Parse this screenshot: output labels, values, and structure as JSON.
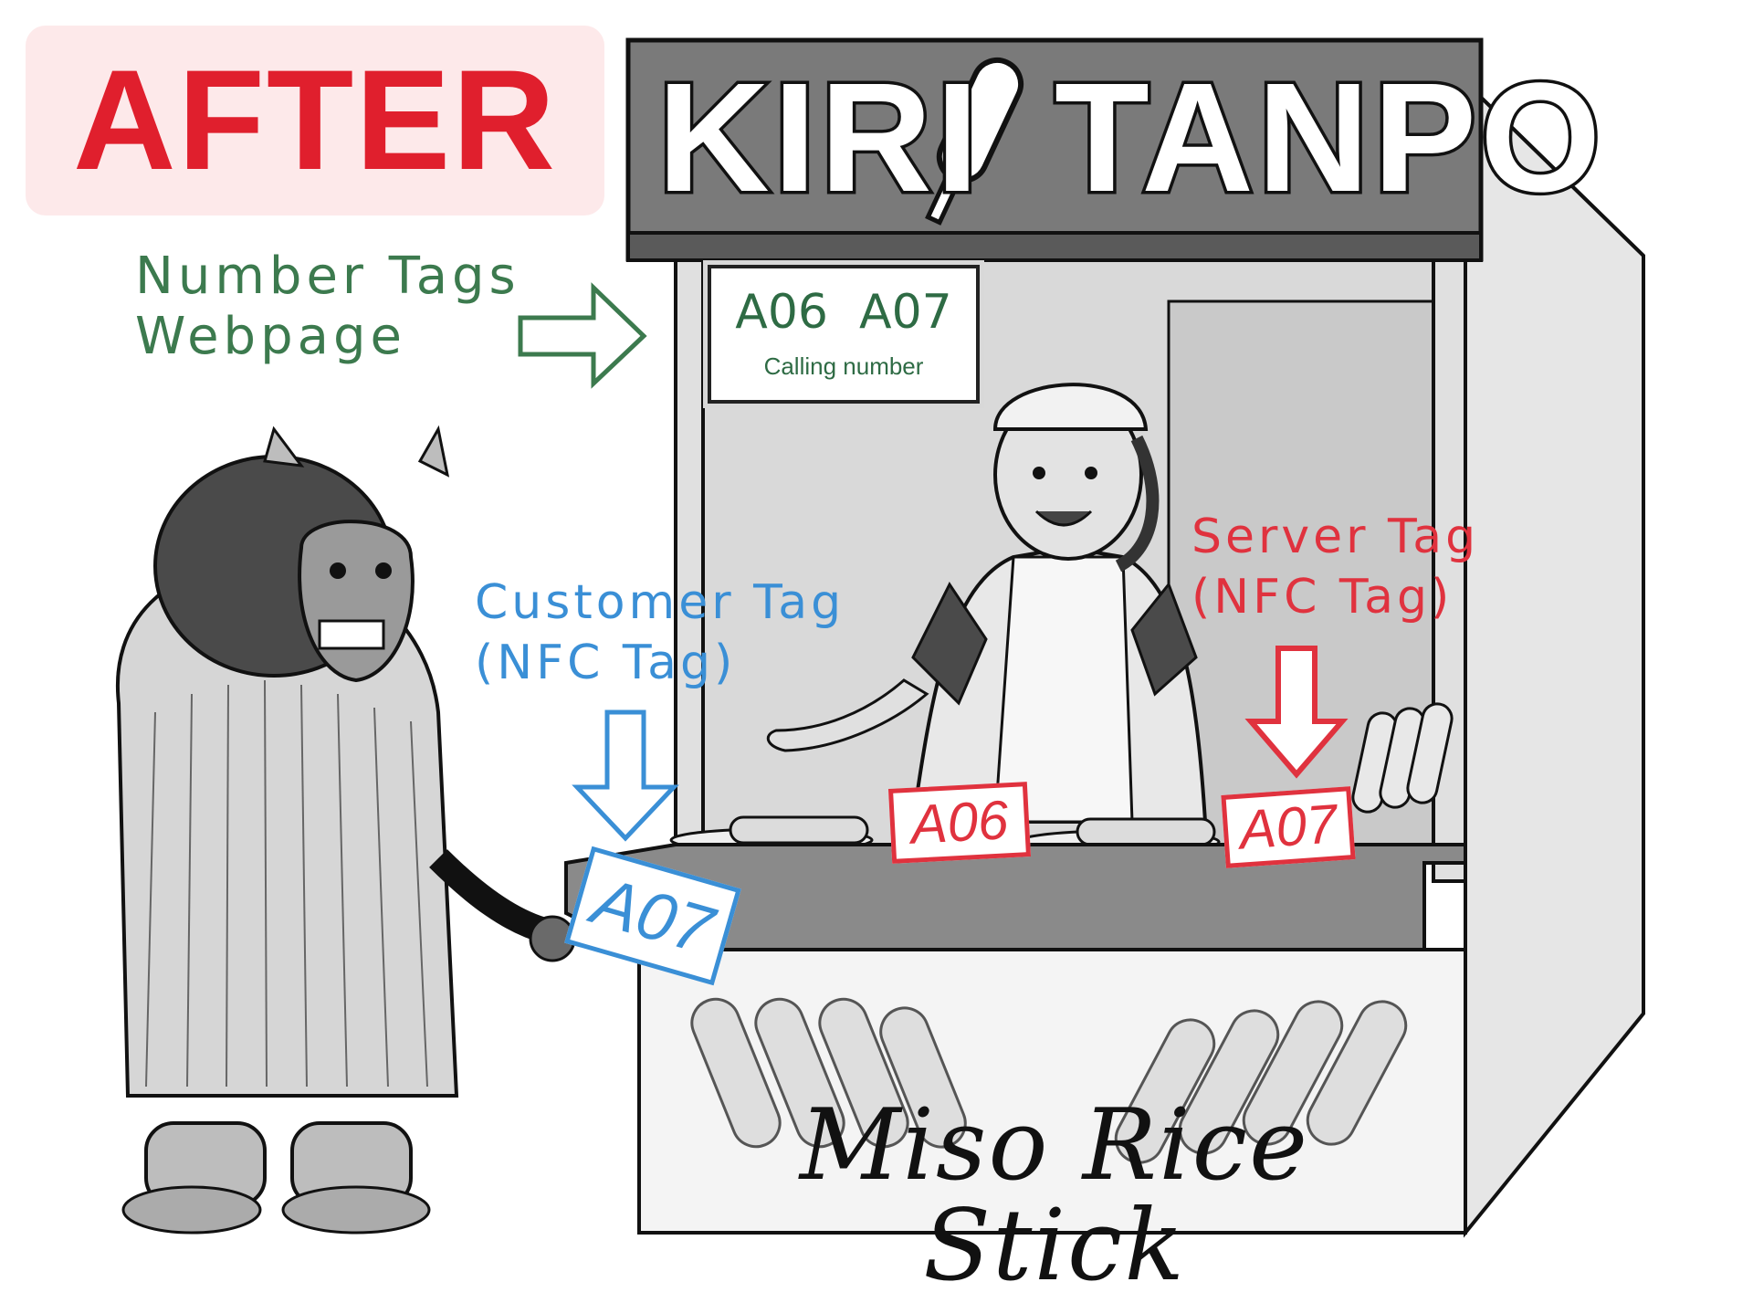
{
  "badge": {
    "label": "AFTER"
  },
  "sign": {
    "left_word": "KIRI",
    "right_word": "TANPO"
  },
  "annotations": {
    "webpage": {
      "line1": "Number Tags",
      "line2": "Webpage"
    },
    "customer_tag": {
      "line1": "Customer Tag",
      "line2": "(NFC Tag)"
    },
    "server_tag": {
      "line1": "Server Tag",
      "line2": "(NFC Tag)"
    }
  },
  "screen": {
    "numbers": [
      "A06",
      "A07"
    ],
    "caption": "Calling number"
  },
  "tags": {
    "counter_a06": "A06",
    "counter_a07": "A07",
    "customer_a07": "A07"
  },
  "bottom_sign": {
    "text": "Miso Rice Stick"
  },
  "colors": {
    "badge_bg": "#fde9ea",
    "badge_text": "#e01f2d",
    "green": "#3c7a4e",
    "blue": "#3a8fd6",
    "red": "#e0323e"
  }
}
